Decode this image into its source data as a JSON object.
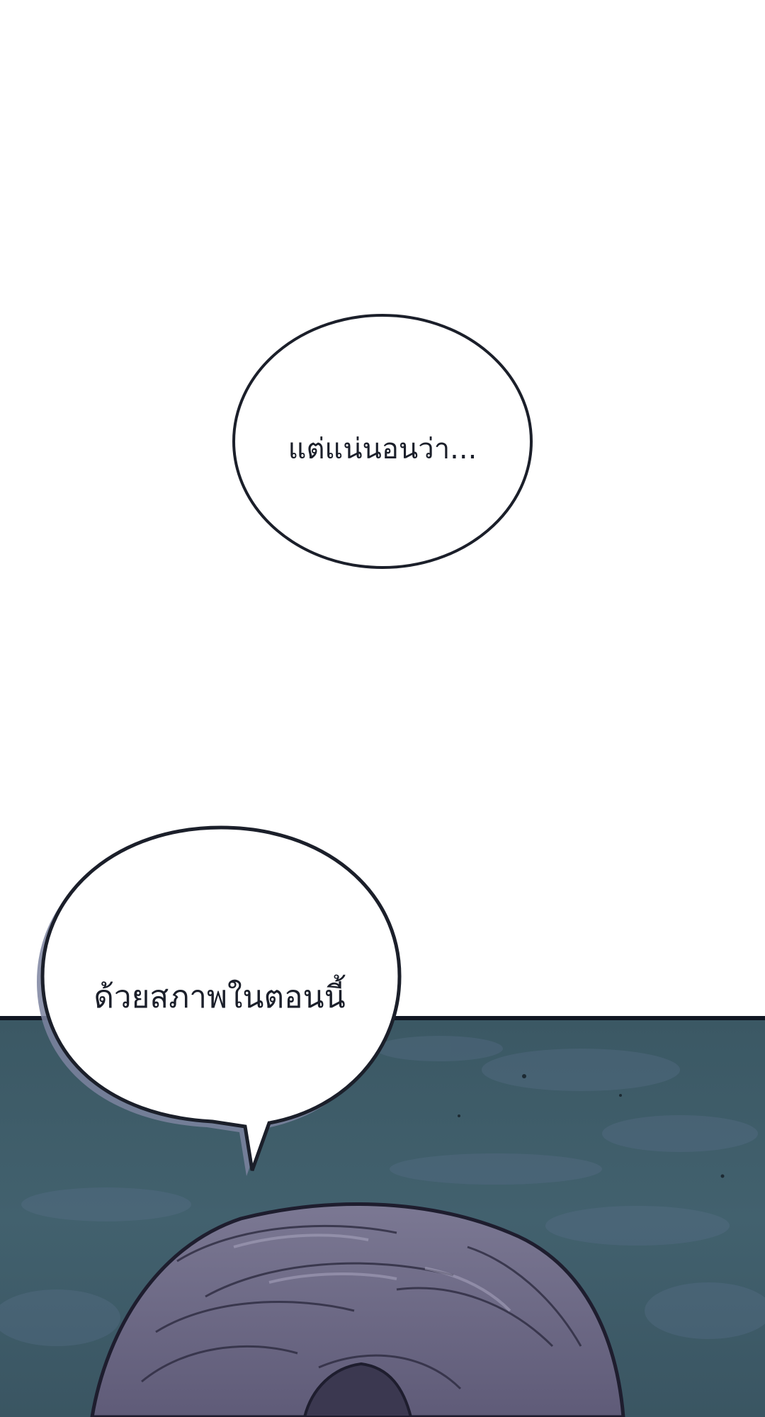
{
  "bubbles": [
    {
      "text": "แต่แน่นอนว่า..."
    },
    {
      "text": "ด้วยสภาพในตอนนี้"
    }
  ],
  "colors": {
    "background": "#ffffff",
    "panel_sky": "#3c5a66",
    "hair": "#6e6a86",
    "outline": "#171c2a"
  }
}
